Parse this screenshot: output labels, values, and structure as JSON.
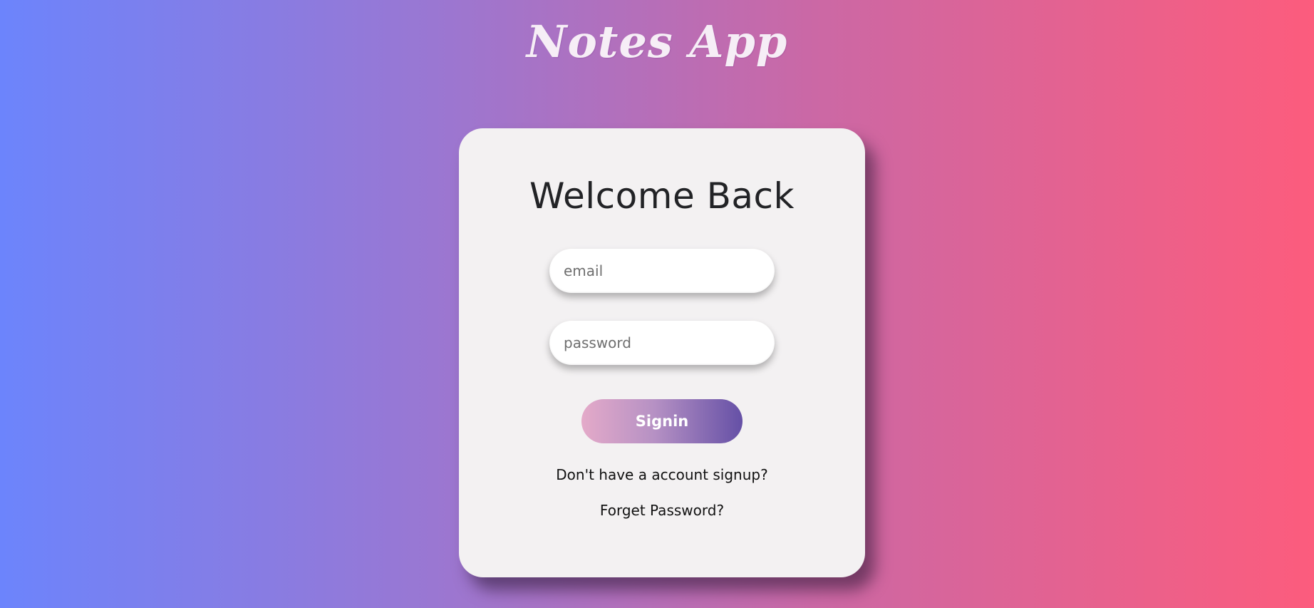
{
  "app": {
    "title": "Notes App"
  },
  "login_card": {
    "heading": "Welcome Back",
    "email_placeholder": "email",
    "password_placeholder": "password",
    "signin_label": "Signin",
    "signup_link": "Don't have a account signup?",
    "forget_password_link": "Forget Password?"
  },
  "colors": {
    "background_start": "#6c84fc",
    "background_end": "#fc5c7d",
    "card_background": "#f3f1f2",
    "button_gradient_start": "#e4aac9",
    "button_gradient_end": "#6550a6"
  }
}
